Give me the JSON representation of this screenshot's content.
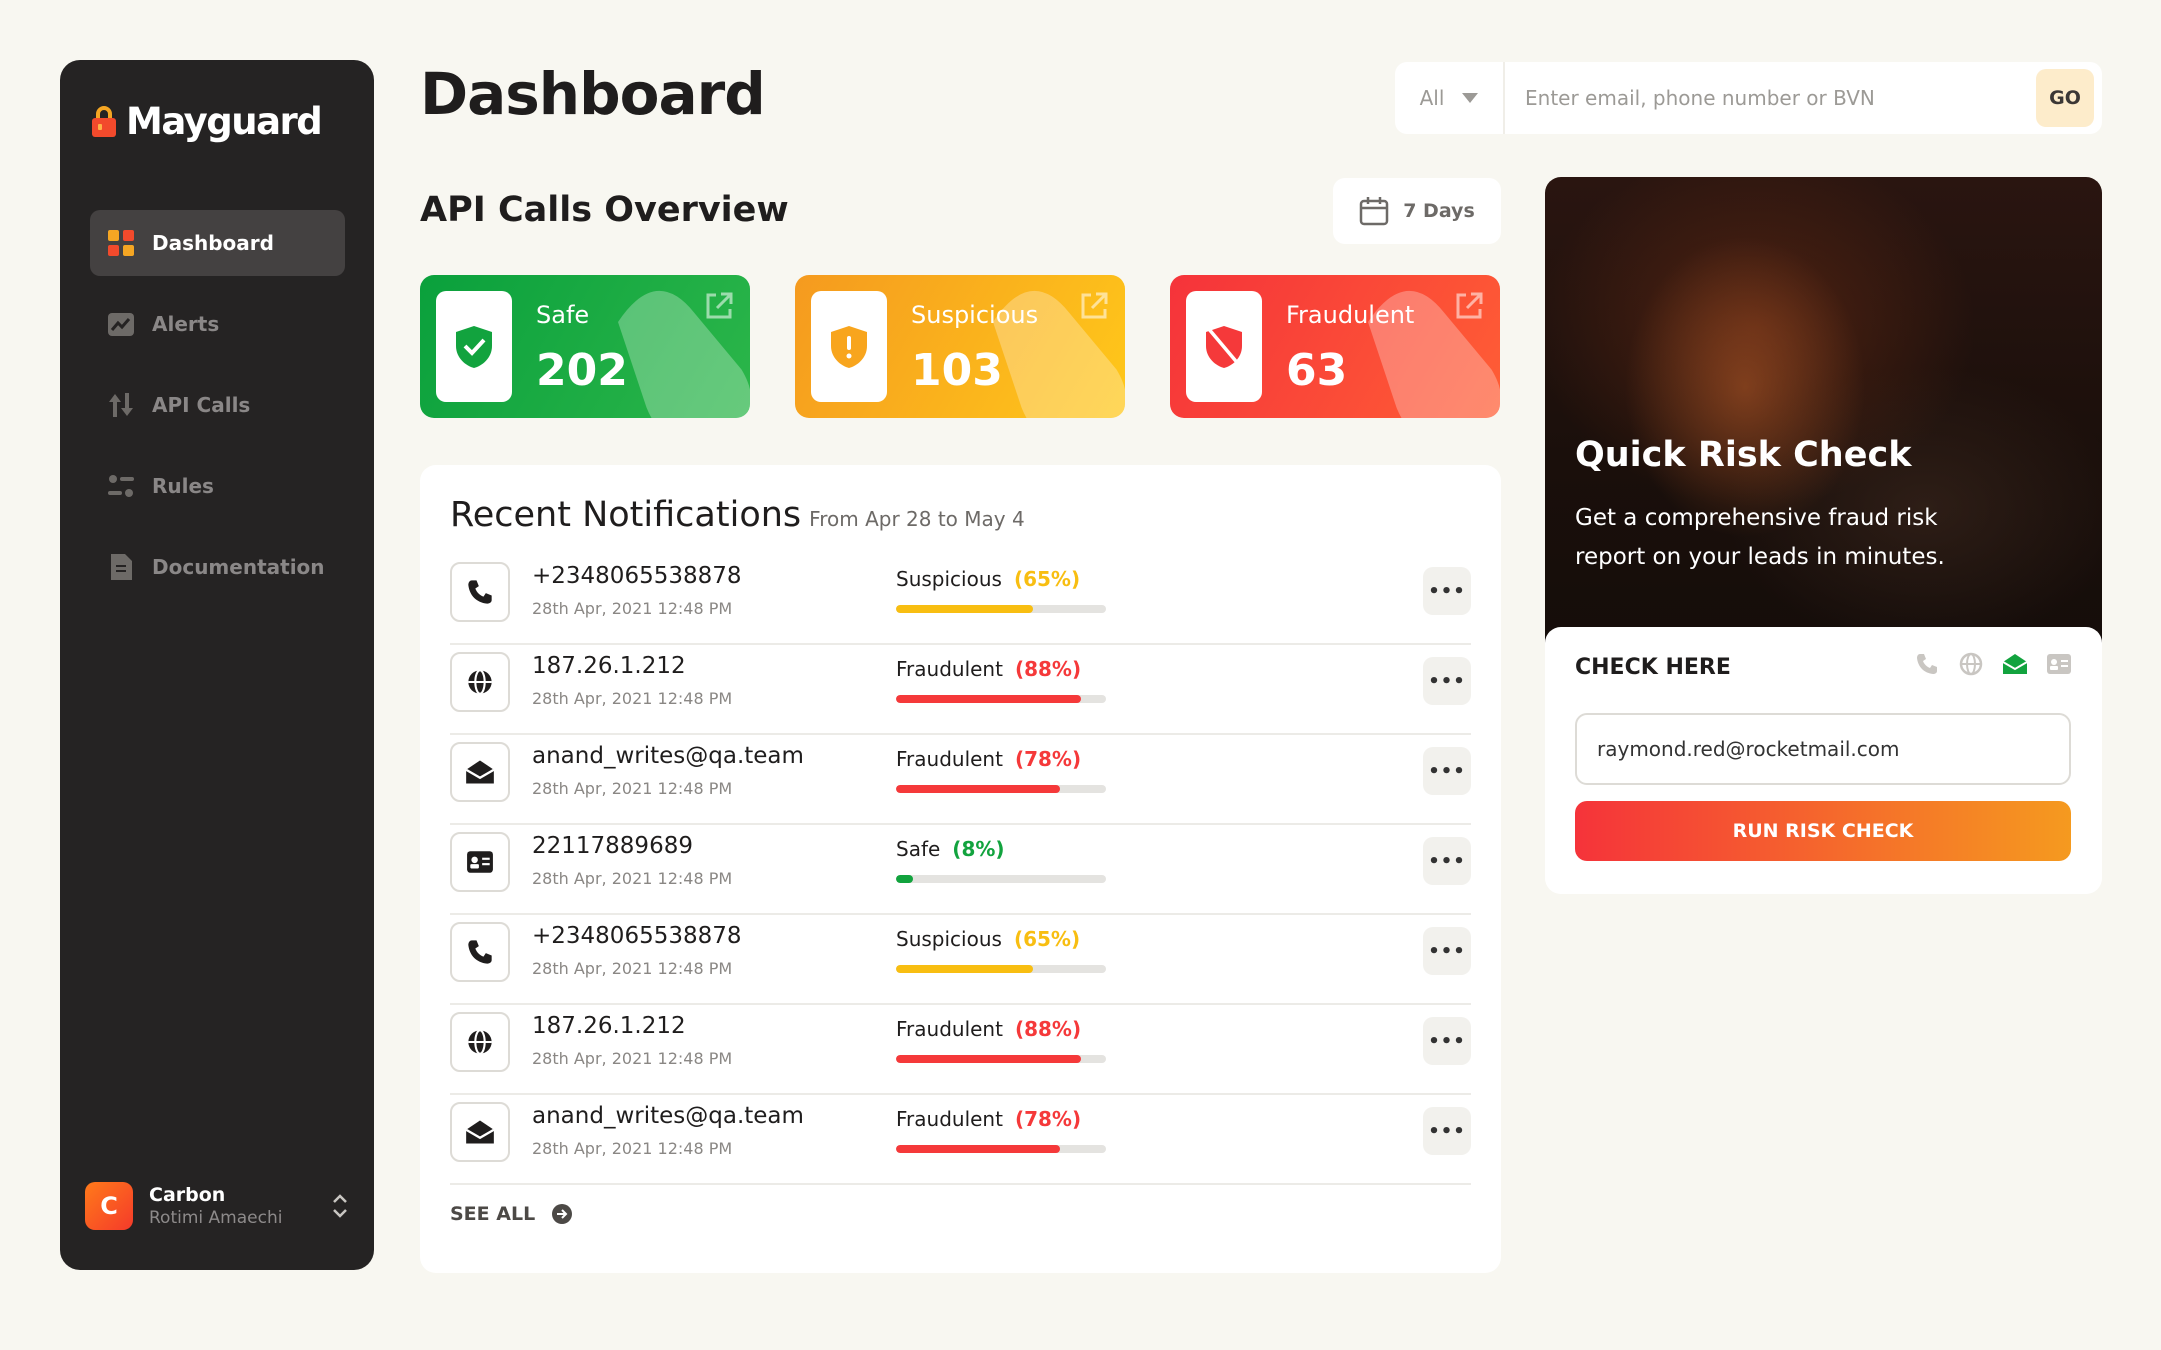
{
  "app": {
    "brand": "Mayguard"
  },
  "sidebar": {
    "items": [
      {
        "label": "Dashboard",
        "icon": "dashboard-grid-icon",
        "active": true
      },
      {
        "label": "Alerts",
        "icon": "chart-alert-icon",
        "active": false
      },
      {
        "label": "API Calls",
        "icon": "transfer-arrows-icon",
        "active": false
      },
      {
        "label": "Rules",
        "icon": "sliders-icon",
        "active": false
      },
      {
        "label": "Documentation",
        "icon": "document-icon",
        "active": false
      }
    ],
    "account": {
      "initial": "C",
      "name": "Carbon",
      "user": "Rotimi Amaechi"
    }
  },
  "header": {
    "title": "Dashboard",
    "search": {
      "filter": "All",
      "placeholder": "Enter email, phone number or BVN",
      "go_label": "GO"
    }
  },
  "overview": {
    "title": "API Calls Overview",
    "range": "7 Days",
    "stats": {
      "safe": {
        "label": "Safe",
        "value": "202",
        "color": "#12a33e"
      },
      "suspicious": {
        "label": "Suspicious",
        "value": "103",
        "color": "#f8a51d"
      },
      "fraudulent": {
        "label": "Fraudulent",
        "value": "63",
        "color": "#f5393a"
      }
    }
  },
  "notifications": {
    "title": "Recent Notifications",
    "range": "From Apr 28 to May 4",
    "rows": [
      {
        "icon": "phone-icon",
        "title": "+2348065538878",
        "date": "28th Apr, 2021 12:48 PM",
        "status": "Suspicious",
        "pct": "(65%)",
        "level": 0.65,
        "color": "#f8be11"
      },
      {
        "icon": "globe-icon",
        "title": "187.26.1.212",
        "date": "28th Apr, 2021 12:48 PM",
        "status": "Fraudulent",
        "pct": "(88%)",
        "level": 0.88,
        "color": "#f5393a"
      },
      {
        "icon": "email-icon",
        "title": "anand_writes@qa.team",
        "date": "28th Apr, 2021 12:48 PM",
        "status": "Fraudulent",
        "pct": "(78%)",
        "level": 0.78,
        "color": "#f5393a"
      },
      {
        "icon": "id-card-icon",
        "title": "22117889689",
        "date": "28th Apr, 2021 12:48 PM",
        "status": "Safe",
        "pct": "(8%)",
        "level": 0.08,
        "color": "#12a33e"
      },
      {
        "icon": "phone-icon",
        "title": "+2348065538878",
        "date": "28th Apr, 2021 12:48 PM",
        "status": "Suspicious",
        "pct": "(65%)",
        "level": 0.65,
        "color": "#f8be11"
      },
      {
        "icon": "globe-icon",
        "title": "187.26.1.212",
        "date": "28th Apr, 2021 12:48 PM",
        "status": "Fraudulent",
        "pct": "(88%)",
        "level": 0.88,
        "color": "#f5393a"
      },
      {
        "icon": "email-icon",
        "title": "anand_writes@qa.team",
        "date": "28th Apr, 2021 12:48 PM",
        "status": "Fraudulent",
        "pct": "(78%)",
        "level": 0.78,
        "color": "#f5393a"
      }
    ],
    "see_all": "SEE ALL"
  },
  "quick_check": {
    "title": "Quick Risk Check",
    "description": "Get a comprehensive fraud risk report on your leads in minutes.",
    "check_label": "CHECK HERE",
    "input_value": "raymond.red@rocketmail.com",
    "button_label": "RUN RISK CHECK",
    "active_type": "email"
  }
}
